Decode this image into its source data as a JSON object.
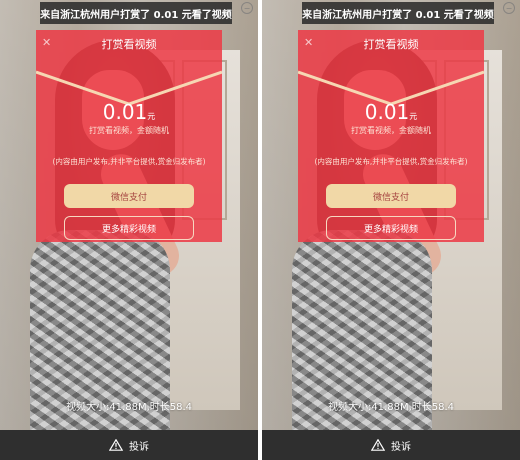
{
  "toast": {
    "text": "来自浙江杭州用户打赏了 0.01 元看了视频"
  },
  "modal": {
    "title": "打赏看视频",
    "close_icon": "close-icon",
    "amount": "0.01",
    "amount_unit": "元",
    "subtitle": "打赏看视频，金额随机",
    "notice": "(内容由用户发布,并非平台提供,赏金归发布者)",
    "pay_button": "微信支付",
    "more_button": "更多精彩视频"
  },
  "video_info": "视频大小:41.88M,时长58.4",
  "footer": {
    "report_label": "投诉",
    "report_icon": "warning-icon"
  },
  "colors": {
    "modal": "#ec3a46",
    "pay_button": "#f1d8a7",
    "footer": "#2f2f2f"
  }
}
